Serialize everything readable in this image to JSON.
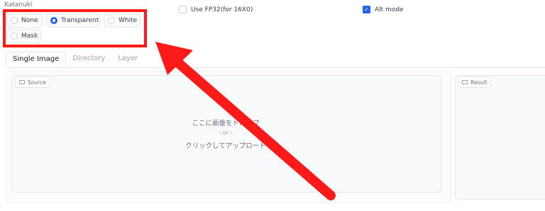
{
  "section": {
    "label": "Katanuki"
  },
  "radio_options": [
    {
      "label": "None",
      "selected": false
    },
    {
      "label": "Transparent",
      "selected": true
    },
    {
      "label": "White",
      "selected": false
    },
    {
      "label": "Mask",
      "selected": false
    }
  ],
  "checkboxes": {
    "fp32": {
      "label": "Use FP32(for 16X0)",
      "checked": false
    },
    "alt_mode": {
      "label": "Alt mode",
      "checked": true
    }
  },
  "tabs": [
    {
      "label": "Single Image",
      "active": true
    },
    {
      "label": "Directory",
      "active": false
    },
    {
      "label": "Layer",
      "active": false
    }
  ],
  "source": {
    "label": "Source",
    "drop_text": "ここに画像をドロップ",
    "or_text": "- or -",
    "upload_text": "クリックしてアップロード"
  },
  "result": {
    "label": "Result"
  },
  "colors": {
    "accent": "#2563eb",
    "highlight": "#ff1a1a"
  },
  "icons": {
    "image": "image-icon",
    "check": "check-icon",
    "arrow": "red-arrow"
  }
}
